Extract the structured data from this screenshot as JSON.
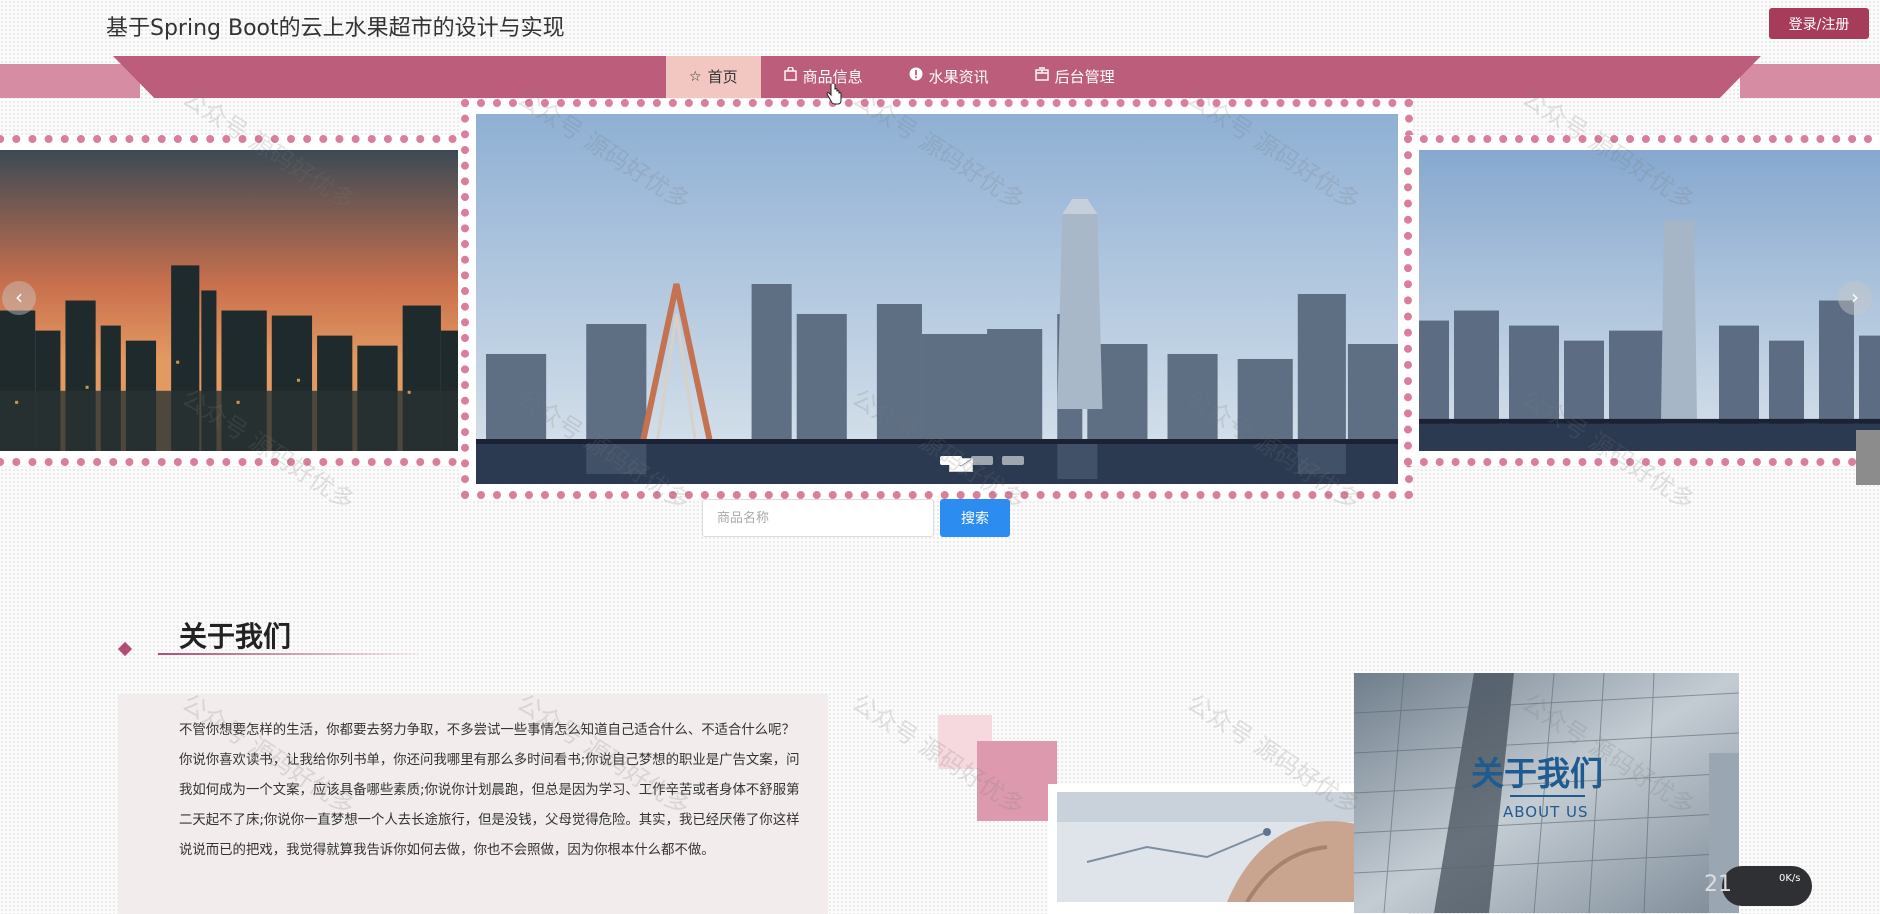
{
  "header": {
    "site_title": "基于Spring Boot的云上水果超市的设计与实现",
    "login_label": "登录/注册"
  },
  "nav": {
    "items": [
      {
        "label": "首页",
        "icon": "star-icon",
        "glyph": "☆",
        "active": true
      },
      {
        "label": "商品信息",
        "icon": "bag-icon",
        "glyph": "🛍",
        "active": false
      },
      {
        "label": "水果资讯",
        "icon": "info-icon",
        "glyph": "❕",
        "active": false
      },
      {
        "label": "后台管理",
        "icon": "package-icon",
        "glyph": "▣",
        "active": false
      }
    ]
  },
  "carousel": {
    "prev_glyph": "‹",
    "next_glyph": "›",
    "slides": [
      {
        "name": "city-sunset"
      },
      {
        "name": "city-river-day"
      },
      {
        "name": "city-skyline"
      }
    ],
    "active_dot": 0,
    "dot_count": 3
  },
  "search": {
    "placeholder": "商品名称",
    "button_label": "搜索"
  },
  "about": {
    "title": "关于我们",
    "text": "不管你想要怎样的生活，你都要去努力争取，不多尝试一些事情怎么知道自己适合什么、不适合什么呢？你说你喜欢读书，让我给你列书单，你还问我哪里有那么多时间看书;你说自己梦想的职业是广告文案，问我如何成为一个文案，应该具备哪些素质;你说你计划晨跑，但总是因为学习、工作辛苦或者身体不舒服第二天起不了床;你说你一直梦想一个人去长途旅行，但是没钱，父母觉得危险。其实，我已经厌倦了你这样说说而已的把戏，我觉得就算我告诉你如何去做，你也不会照做，因为你根本什么都不做。",
    "image_title": "关于我们",
    "image_subtitle": "ABOUT US"
  },
  "watermark": "公众号 源码好优多",
  "speed_widget": {
    "value": "21",
    "rate": "0K/s"
  },
  "colors": {
    "accent": "#bc5d7c",
    "login": "#a63b5a",
    "search": "#2d8cf0",
    "frame_dots": "#d97f9c"
  }
}
